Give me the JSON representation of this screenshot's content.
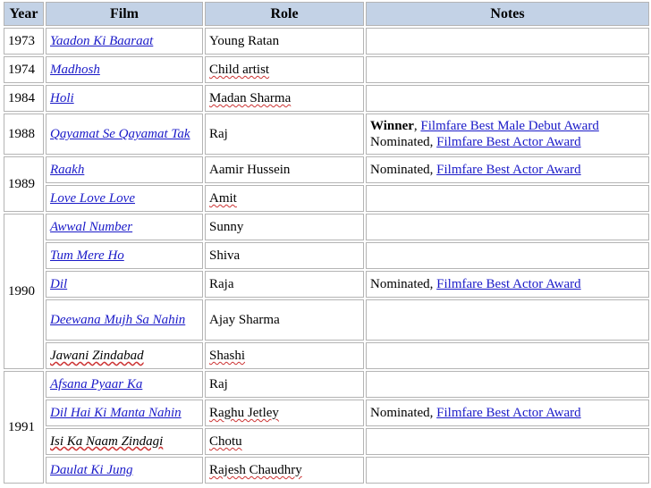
{
  "headers": {
    "year": "Year",
    "film": "Film",
    "role": "Role",
    "notes": "Notes"
  },
  "rows": [
    {
      "year": "1973",
      "film": "Yaadon Ki Baaraat",
      "role": "Young Ratan"
    },
    {
      "year": "1974",
      "film": "Madhosh",
      "role": "Child artist"
    },
    {
      "year": "1984",
      "film": "Holi",
      "role": "Madan Sharma"
    },
    {
      "year": "1988",
      "film": "Qayamat Se Qayamat Tak",
      "role": "Raj",
      "notes1_prefix": "Winner",
      "notes1_sep": ", ",
      "notes1_link": "Filmfare Best Male Debut Award",
      "notes2_prefix": "Nominated, ",
      "notes2_link": "Filmfare Best Actor Award"
    },
    {
      "year": "1989",
      "film": "Raakh",
      "role": "Aamir Hussein",
      "notes_prefix": "Nominated, ",
      "notes_link": "Filmfare Best Actor Award"
    },
    {
      "film": "Love Love Love",
      "role": "Amit"
    },
    {
      "year": "1990",
      "film": "Awwal Number",
      "role": "Sunny"
    },
    {
      "film": "Tum Mere Ho",
      "role": "Shiva"
    },
    {
      "film": "Dil",
      "role": "Raja",
      "notes_prefix": "Nominated, ",
      "notes_link": "Filmfare Best Actor Award"
    },
    {
      "film": "Deewana Mujh Sa Nahin",
      "role": "Ajay Sharma"
    },
    {
      "film": "Jawani Zindabad",
      "role": "Shashi"
    },
    {
      "year": "1991",
      "film": "Afsana Pyaar Ka",
      "role": "Raj"
    },
    {
      "film": "Dil Hai Ki Manta Nahin",
      "role": "Raghu Jetley",
      "notes_prefix": "Nominated, ",
      "notes_link": "Filmfare Best Actor Award"
    },
    {
      "film": "Isi Ka Naam Zindagi",
      "role": "Chotu"
    },
    {
      "film": "Daulat Ki Jung",
      "role": "Rajesh Chaudhry"
    }
  ]
}
